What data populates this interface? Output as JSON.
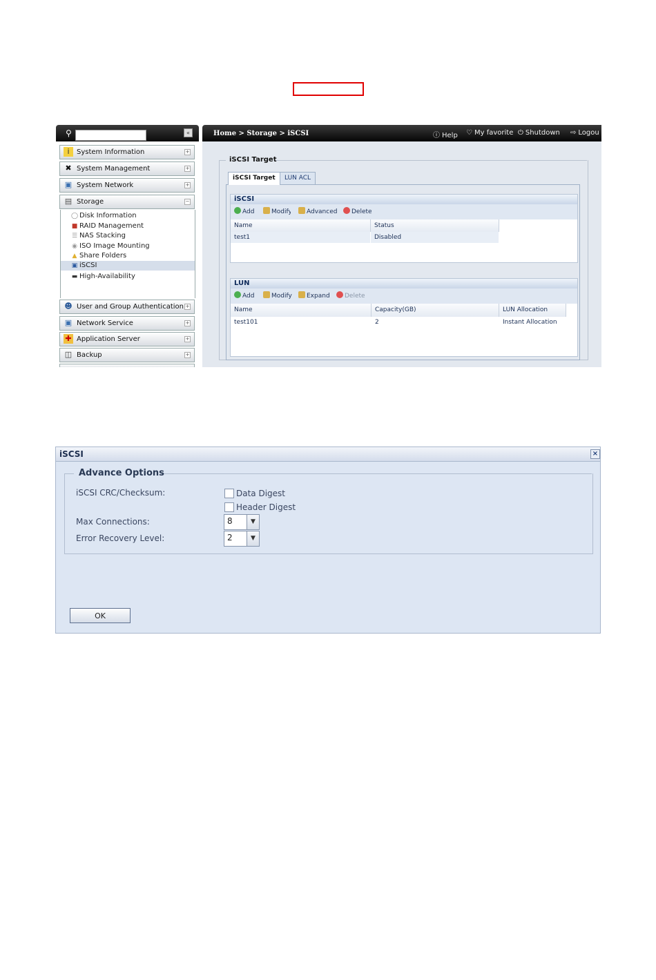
{
  "top": {
    "sidebar": {
      "search_placeholder": "",
      "collapse_glyph": "«",
      "menu": [
        {
          "label": "System Information",
          "icon": "info-icon"
        },
        {
          "label": "System Management",
          "icon": "tools-icon"
        },
        {
          "label": "System Network",
          "icon": "network-icon"
        },
        {
          "label": "Storage",
          "icon": "storage-icon"
        },
        {
          "label": "User and Group Authentication",
          "icon": "users-icon"
        },
        {
          "label": "Network Service",
          "icon": "network-service-icon"
        },
        {
          "label": "Application Server",
          "icon": "application-icon"
        },
        {
          "label": "Backup",
          "icon": "backup-icon"
        }
      ],
      "storage_items": [
        {
          "label": "Disk Information"
        },
        {
          "label": "RAID Management"
        },
        {
          "label": "NAS Stacking"
        },
        {
          "label": "ISO Image Mounting"
        },
        {
          "label": "Share Folders"
        },
        {
          "label": "iSCSI"
        },
        {
          "label": "High-Availability"
        }
      ],
      "active_item": "iSCSI"
    },
    "header": {
      "breadcrumb": "Home > Storage > iSCSI",
      "help": "Help",
      "favorite": "My favorite",
      "shutdown": "Shutdown",
      "logout": "Logou"
    },
    "fieldset_title": "iSCSI Target",
    "tabs": [
      {
        "label": "iSCSI Target",
        "active": true
      },
      {
        "label": "LUN ACL",
        "active": false
      }
    ],
    "iscsi_grid": {
      "title": "iSCSI",
      "toolbar": [
        "Add",
        "Modify",
        "Advanced",
        "Delete"
      ],
      "columns": [
        "Name",
        "Status"
      ],
      "rows": [
        [
          "test1",
          "Disabled"
        ]
      ]
    },
    "lun_grid": {
      "title": "LUN",
      "toolbar": [
        "Add",
        "Modify",
        "Expand",
        "Delete"
      ],
      "columns": [
        "Name",
        "Capacity(GB)",
        "LUN Allocation"
      ],
      "rows": [
        [
          "test101",
          "2",
          "Instant Allocation"
        ]
      ]
    },
    "highlight_color": "#e00000"
  },
  "dialog": {
    "title": "iSCSI",
    "close_glyph": "×",
    "section_title": "Advance Options",
    "crc_label": "iSCSI CRC/Checksum:",
    "data_digest": "Data Digest",
    "header_digest": "Header Digest",
    "max_conn_label": "Max Connections:",
    "max_conn_value": "8",
    "err_label": "Error Recovery Level:",
    "err_value": "2",
    "ok_label": "OK"
  }
}
